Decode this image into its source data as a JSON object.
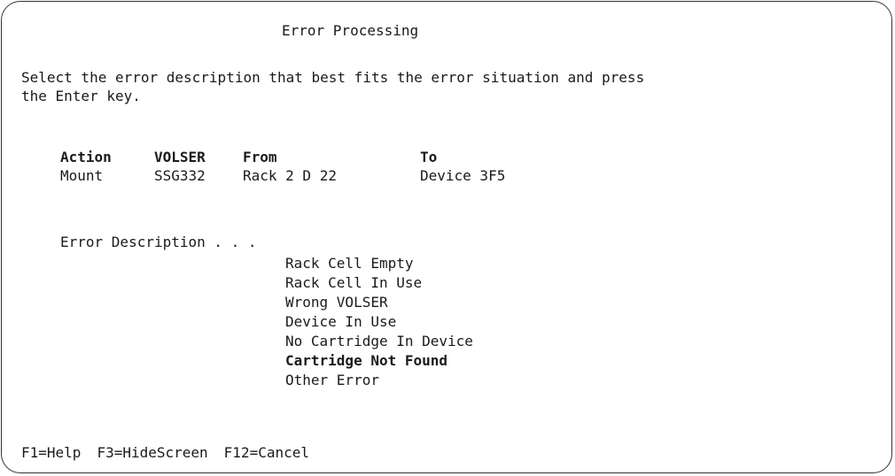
{
  "screen": {
    "title": "Error Processing",
    "instruction_line1": "Select the error description that best fits the error situation and press",
    "instruction_line2": "the Enter key."
  },
  "table": {
    "headers": {
      "action": "Action",
      "volser": "VOLSER",
      "from": "From",
      "to": "To"
    },
    "row": {
      "action": "Mount",
      "volser": "SSG332",
      "from": "Rack 2 D 22",
      "to": "Device 3F5"
    }
  },
  "error_description": {
    "label": "Error Description . . .",
    "options": [
      "Rack Cell Empty",
      "Rack Cell In Use",
      "Wrong VOLSER",
      "Device In Use",
      "No Cartridge In Device",
      "Cartridge Not Found",
      "Other Error"
    ],
    "selected_index": 5
  },
  "function_keys": [
    "F1=Help",
    "F3=HideScreen",
    "F12=Cancel"
  ]
}
